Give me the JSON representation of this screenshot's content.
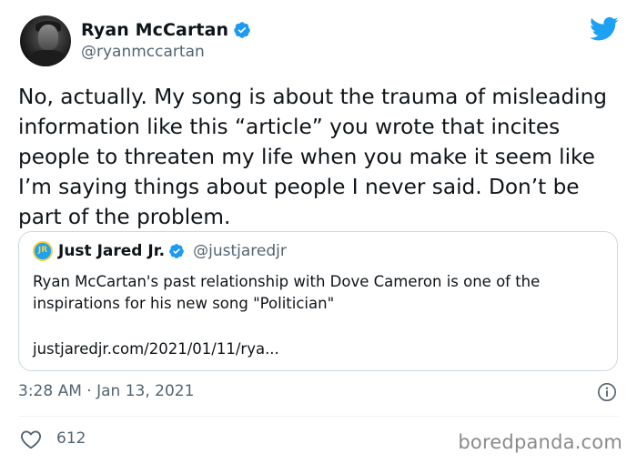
{
  "author": {
    "display_name": "Ryan McCartan",
    "handle": "@ryanmccartan",
    "verified": true
  },
  "tweet": {
    "text": "No, actually. My song is about the trauma of misleading information like this “article” you wrote that incites people to threaten my life when you make it seem like I’m saying things about people I never said. Don’t be part of the problem."
  },
  "quoted_tweet": {
    "avatar_text": "JR",
    "display_name": "Just Jared Jr.",
    "handle": "@justjaredjr",
    "verified": true,
    "text": "Ryan McCartan's past relationship with Dove Cameron is one of the inspirations for his new song \"Politician\"",
    "link": "justjaredjr.com/2021/01/11/rya..."
  },
  "meta": {
    "timestamp": "3:28 AM · Jan 13, 2021",
    "like_count": "612"
  },
  "watermark": "boredpanda.com",
  "icons": {
    "brand": "twitter-bird-icon",
    "verified": "verified-badge-icon",
    "info": "info-icon",
    "like": "heart-icon"
  },
  "colors": {
    "twitter_blue": "#1da1f2",
    "verified_blue": "#1d9bf0",
    "secondary_text": "#536471",
    "border": "#cfd9de",
    "like_icon": "#536471"
  }
}
